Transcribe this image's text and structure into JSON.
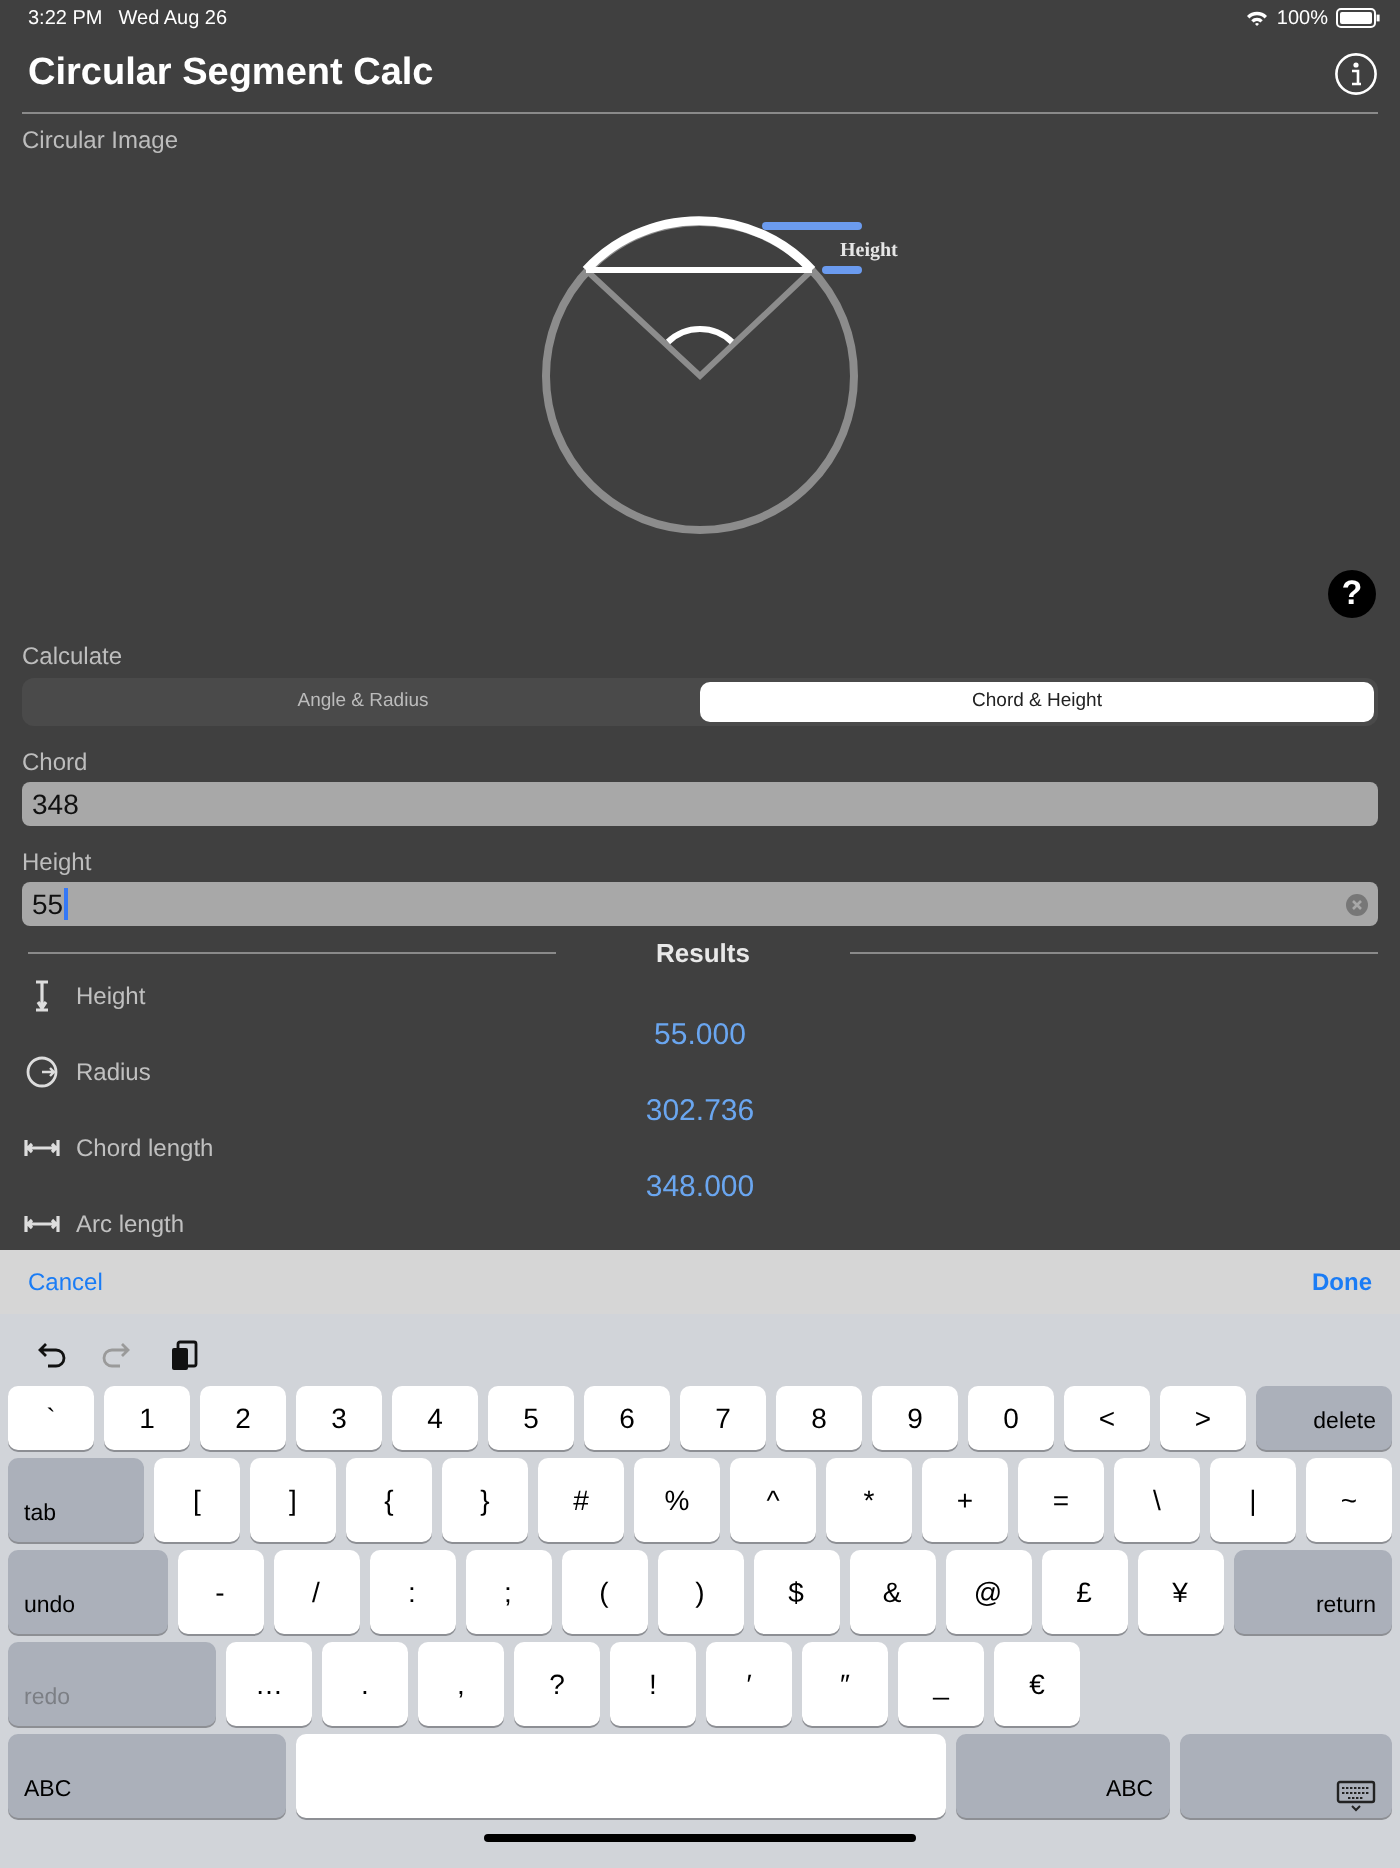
{
  "status_bar": {
    "time": "3:22 PM",
    "date": "Wed Aug 26",
    "battery": "100%"
  },
  "title": "Circular Segment Calc",
  "image_section": {
    "label": "Circular Image",
    "diagram_label": "Height",
    "help": "?"
  },
  "calculate": {
    "label": "Calculate",
    "segments": [
      {
        "label": "Angle & Radius",
        "selected": false
      },
      {
        "label": "Chord & Height",
        "selected": true
      }
    ]
  },
  "fields": [
    {
      "label": "Chord",
      "value": "348",
      "focused": false
    },
    {
      "label": "Height",
      "value": "55",
      "focused": true
    }
  ],
  "results": {
    "title": "Results",
    "rows": [
      {
        "kind": "height",
        "label": "Height",
        "value": "55.000"
      },
      {
        "kind": "radius",
        "label": "Radius",
        "value": "302.736"
      },
      {
        "kind": "chord",
        "label": "Chord length",
        "value": "348.000"
      },
      {
        "kind": "arc",
        "label": "Arc length"
      }
    ]
  },
  "keyboard_toolbar": {
    "cancel": "Cancel",
    "done": "Done",
    "shortcuts": [
      {
        "kind": "undo",
        "disabled": false
      },
      {
        "kind": "redo",
        "disabled": true
      },
      {
        "kind": "paste",
        "disabled": false
      }
    ]
  },
  "keyboard_rows": [
    [
      {
        "label": "`",
        "kind": "char",
        "disabled": false
      },
      {
        "label": "1",
        "kind": "char",
        "disabled": false
      },
      {
        "label": "2",
        "kind": "char",
        "disabled": false
      },
      {
        "label": "3",
        "kind": "char",
        "disabled": false
      },
      {
        "label": "4",
        "kind": "char",
        "disabled": false
      },
      {
        "label": "5",
        "kind": "char",
        "disabled": false
      },
      {
        "label": "6",
        "kind": "char",
        "disabled": false
      },
      {
        "label": "7",
        "kind": "char",
        "disabled": false
      },
      {
        "label": "8",
        "kind": "char",
        "disabled": false
      },
      {
        "label": "9",
        "kind": "char",
        "disabled": false
      },
      {
        "label": "0",
        "kind": "char",
        "disabled": false
      },
      {
        "label": "<",
        "kind": "char",
        "disabled": false
      },
      {
        "label": ">",
        "kind": "char",
        "disabled": false
      },
      {
        "label": "delete",
        "kind": "right",
        "disabled": false
      }
    ],
    [
      {
        "label": "tab",
        "kind": "left",
        "disabled": false
      },
      {
        "label": "[",
        "kind": "char",
        "disabled": false
      },
      {
        "label": "]",
        "kind": "char",
        "disabled": false
      },
      {
        "label": "{",
        "kind": "char",
        "disabled": false
      },
      {
        "label": "}",
        "kind": "char",
        "disabled": false
      },
      {
        "label": "#",
        "kind": "char",
        "disabled": false
      },
      {
        "label": "%",
        "kind": "char",
        "disabled": false
      },
      {
        "label": "^",
        "kind": "char",
        "disabled": false
      },
      {
        "label": "*",
        "kind": "char",
        "disabled": false
      },
      {
        "label": "+",
        "kind": "char",
        "disabled": false
      },
      {
        "label": "=",
        "kind": "char",
        "disabled": false
      },
      {
        "label": "\\",
        "kind": "char",
        "disabled": false
      },
      {
        "label": "|",
        "kind": "char",
        "disabled": false
      },
      {
        "label": "~",
        "kind": "char",
        "disabled": false
      }
    ],
    [
      {
        "label": "undo",
        "kind": "left",
        "disabled": false
      },
      {
        "label": "-",
        "kind": "char",
        "disabled": false
      },
      {
        "label": "/",
        "kind": "char",
        "disabled": false
      },
      {
        "label": ":",
        "kind": "char",
        "disabled": false
      },
      {
        "label": ";",
        "kind": "char",
        "disabled": false
      },
      {
        "label": "(",
        "kind": "char",
        "disabled": false
      },
      {
        "label": ")",
        "kind": "char",
        "disabled": false
      },
      {
        "label": "$",
        "kind": "char",
        "disabled": false
      },
      {
        "label": "&",
        "kind": "char",
        "disabled": false
      },
      {
        "label": "@",
        "kind": "char",
        "disabled": false
      },
      {
        "label": "£",
        "kind": "char",
        "disabled": false
      },
      {
        "label": "¥",
        "kind": "char",
        "disabled": false
      },
      {
        "label": "return",
        "kind": "right",
        "disabled": false
      }
    ],
    [
      {
        "label": "redo",
        "kind": "left",
        "disabled": true
      },
      {
        "label": "…",
        "kind": "char",
        "disabled": false
      },
      {
        "label": ".",
        "kind": "char",
        "disabled": false
      },
      {
        "label": ",",
        "kind": "char",
        "disabled": false
      },
      {
        "label": "?",
        "kind": "char",
        "disabled": false
      },
      {
        "label": "!",
        "kind": "char",
        "disabled": false
      },
      {
        "label": "′",
        "kind": "char",
        "disabled": false
      },
      {
        "label": "″",
        "kind": "char",
        "disabled": false
      },
      {
        "label": "_",
        "kind": "char",
        "disabled": false
      },
      {
        "label": "€",
        "kind": "char",
        "disabled": false
      },
      {
        "kind": "gap"
      }
    ],
    [
      {
        "label": "ABC",
        "kind": "left",
        "disabled": false
      },
      {
        "kind": "space",
        "disabled": false
      },
      {
        "label": "ABC",
        "kind": "right",
        "disabled": false
      },
      {
        "kind": "hide",
        "disabled": false
      }
    ]
  ]
}
